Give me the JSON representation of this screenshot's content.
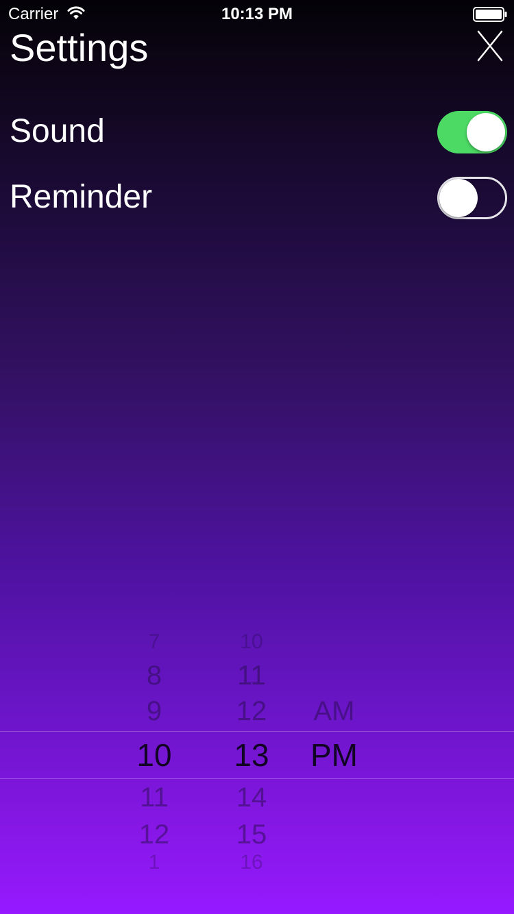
{
  "status_bar": {
    "carrier": "Carrier",
    "time": "10:13 PM",
    "wifi_icon": "wifi-icon",
    "battery_icon": "battery-icon"
  },
  "header": {
    "title": "Settings",
    "close_icon": "close-icon"
  },
  "settings": [
    {
      "label": "Sound",
      "enabled": true
    },
    {
      "label": "Reminder",
      "enabled": false
    }
  ],
  "colors": {
    "toggle_on": "#4cd964",
    "background_top": "#030207",
    "background_bottom": "#9619ff"
  },
  "time_picker": {
    "hours": [
      "7",
      "8",
      "9",
      "10",
      "11",
      "12",
      "1"
    ],
    "minutes": [
      "10",
      "11",
      "12",
      "13",
      "14",
      "15",
      "16"
    ],
    "periods": [
      "AM",
      "PM"
    ],
    "selected": {
      "hour": "10",
      "minute": "13",
      "period": "PM"
    }
  }
}
